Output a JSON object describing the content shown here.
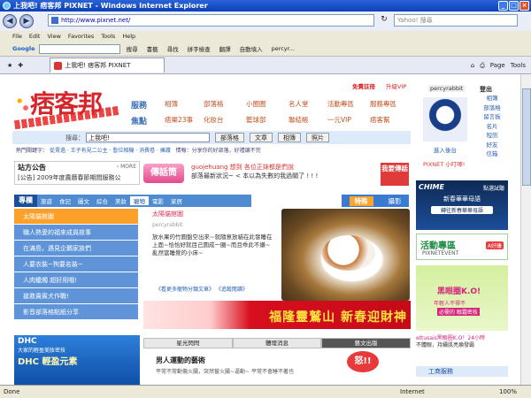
{
  "window": {
    "title": "上我吧! 痞客邦 PIXNET - Windows Internet Explorer"
  },
  "address": {
    "url": "http://www.pixnet.net/",
    "search_placeholder": "Yahoo! 搜尋"
  },
  "menu": [
    "File",
    "Edit",
    "View",
    "Favorites",
    "Tools",
    "Help"
  ],
  "toolbar": {
    "google": "Google",
    "search": "搜尋",
    "bookmarks": "書籤",
    "find": "尋找",
    "spell": "拼字檢查",
    "translate": "翻譯",
    "autofill": "自動填入",
    "user": "percyr..."
  },
  "favbar": {
    "tab_title": "上我吧! 痞客邦 PIXNET",
    "page_cmd": "Page",
    "tools_cmd": "Tools"
  },
  "site": {
    "logo": "痞客邦",
    "top_links": [
      "免費註冊",
      "升級VIP"
    ],
    "cat_labels": [
      "服務",
      "焦點"
    ],
    "cat_row1": [
      "相簿",
      "部落格",
      "小圈圈",
      "名人堂",
      "活動專區",
      "服務專區"
    ],
    "cat_row2": [
      "痞樂23事",
      "化妝台",
      "籃球部",
      "聯結帳",
      "一元VIP",
      "痞客幫"
    ],
    "search_label": "搜尋：",
    "search_value": "上我吧!",
    "search_buttons": [
      "部落格",
      "文章",
      "相簿",
      "照片"
    ],
    "hot_keywords_label": "熱門關鍵字：",
    "hot_keywords": "從賣過 · 王子有見二公主 · 暫位相機 · 消費卷 · 擁護",
    "notice": "情報：分享你的好部落，好禮讓不完",
    "station_title": "站方公告",
    "more": "› MORE",
    "station_text": "[公告] 2009年度農曆春節期間服務公",
    "chuan": "傳話筒",
    "uid": "guojehuang 想到 各位正妹都是們說",
    "umsg": "部落最新狀況~ < 本以為失數的我過關了 ! ! !",
    "want": "我要傳話",
    "topic_head": "專欄",
    "topics": [
      "旅遊",
      "食記",
      "圖文",
      "綜合",
      "美妝",
      "寵物",
      "電影",
      "家居"
    ],
    "tezhong": [
      "特殊",
      "攝影"
    ],
    "side_items": [
      "太陽貓館圖",
      "職人熱愛的福來成員故事",
      "在滿島，遇見企鵝家族們",
      "人要衣裝~狗要名裝~",
      "人肉蠟燭 超好用哦!",
      "搶救貴賓犬作戰!",
      "影音部落格點紙分享"
    ],
    "feat_subtitle": "太陽貓館圖",
    "feat_user": "percyrabbit",
    "feat_desc": "放水果的竹圓盤空出來~就隨意放貓在此發睡在上面~恰恰好就目己圍成一圈~而且乖此不嫌~亂然當睡覺的小床~",
    "feat_links": "《看更多寵物分類文章》 《追蹤閱讀》",
    "banner": "福隆靈鷲山  新春迎財神",
    "dhc": {
      "logo": "DHC",
      "sub": "大家的輕盈美妝密技",
      "big": "DHC 輕盈元素"
    },
    "rtabs": [
      "星光閃閃",
      "體壇消息",
      "藝文出版"
    ],
    "article_title": "男人運動的藝術",
    "article_desc": "平常不常動傷火腸，突然嘗火腸~逼動~ 平常不會睡不著也",
    "angry": "怒!!"
  },
  "user_panel": {
    "name": "percyrabbit",
    "logout": "登出",
    "back": "進入後台",
    "pix": "PIXNET 小叮嚀!",
    "menu": [
      "相簿",
      "部落格",
      "留言板",
      "名片",
      "短訊",
      "好友",
      "信箱"
    ]
  },
  "ads": {
    "chime_logo": "CHIME",
    "chime_ts": "點選試聽",
    "chime_msg": "新春華華母語",
    "chime_btn": "轉往新春華華母語",
    "event_title": "活動專區",
    "event_sub": "PIXNETEVENT",
    "event_badge": "A好康",
    "ettu_title": "黑眼圈K.O!",
    "ettu_a": "年輕人不得不",
    "ettu_b": "必需的 眼霜密技",
    "ettu_caption1": "ettusais黑眼圈K.O！24小時",
    "ettu_caption2": "不體眼，持續肌亮煥發霸",
    "gongshang": "工商服務"
  },
  "status": {
    "left": "Done",
    "zone": "Internet",
    "zoom": "100%"
  },
  "colors": {
    "brand": "#d6252b",
    "blue": "#4f8bd1",
    "accent": "#fda02a"
  }
}
